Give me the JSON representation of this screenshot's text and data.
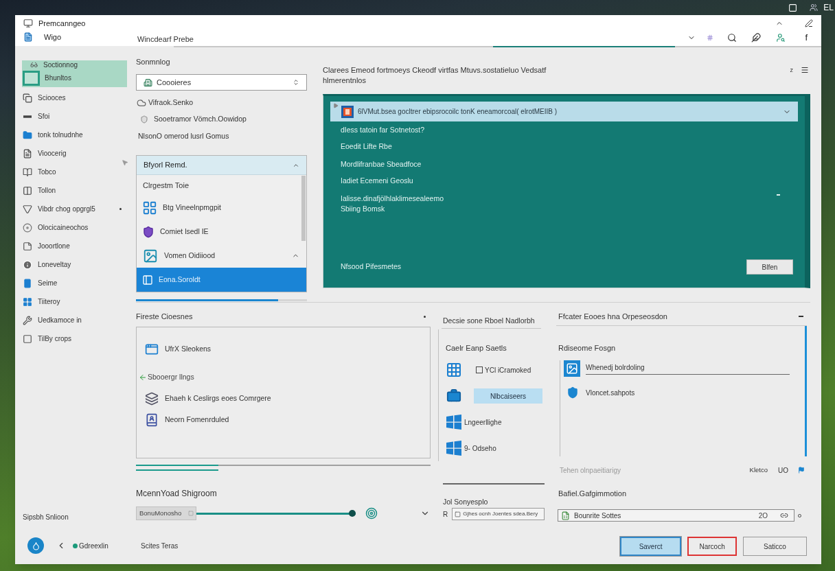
{
  "tray": {
    "label": "EL"
  },
  "window": {
    "app_name": "Premcanngeo",
    "section": "Wigo",
    "title": "Wincdearf Prebe",
    "toolbar_glyph": "f"
  },
  "sidebar": {
    "items": [
      {
        "kind": "caption",
        "label": "Soctionnog",
        "selected": true
      },
      {
        "kind": "tile",
        "label": "Bhunltos",
        "selected": true
      },
      {
        "kind": "item",
        "label": "Sciooces",
        "selected": false
      },
      {
        "kind": "item",
        "label": "Sfoi",
        "selected": false
      },
      {
        "kind": "item",
        "label": "tonk tolnudnhe",
        "selected": false
      },
      {
        "kind": "item",
        "label": "Vioocerig",
        "selected": false
      },
      {
        "kind": "item",
        "label": "Tobco",
        "selected": false
      },
      {
        "kind": "item",
        "label": "Tollon",
        "selected": false
      },
      {
        "kind": "item",
        "label": "Vibdr chog opgrgl5",
        "selected": false,
        "has_dot": true
      },
      {
        "kind": "item",
        "label": "Olocicaineochos",
        "selected": false
      },
      {
        "kind": "item",
        "label": "Jooortlone",
        "selected": false
      },
      {
        "kind": "item",
        "label": "Loneveltay",
        "selected": false
      },
      {
        "kind": "item",
        "label": "Seime",
        "selected": false
      },
      {
        "kind": "item",
        "label": "Tiiteroy",
        "selected": false
      },
      {
        "kind": "item",
        "label": "Uedkamoce in",
        "selected": false
      },
      {
        "kind": "item",
        "label": "TilBy crops",
        "selected": false
      }
    ],
    "footer": "Sipsbh Snlioon"
  },
  "bottom_bar": {
    "status": "Gdreexlin",
    "link": "Scites Teras"
  },
  "search_panel": {
    "label": "Sonmnlog",
    "dropdown": {
      "value": "Coooieres"
    },
    "options": [
      "Vifraok.Senko",
      "Sooetramor Vömch.Oowidop"
    ],
    "note": "NlsonO omerod lusrl Gomus",
    "list": {
      "header": "Bfyorl Remd.",
      "group": "Clrgestm Toie",
      "items": [
        {
          "label": "Btg Vineelnpmgpit",
          "selected": false
        },
        {
          "label": "Comiet lsedl IE",
          "selected": false
        },
        {
          "label": "Vomen Oidiiood",
          "selected": false,
          "expandable": true
        },
        {
          "label": "Eona.Soroldt",
          "selected": true
        }
      ]
    },
    "progress": {
      "level": 0.83
    }
  },
  "notice": {
    "text": "Clarees Emeod fortmoeys Ckeodf virtfas Mtuvs.sostatieluo Vedsatf hlmerentnlos",
    "badge": "z"
  },
  "card": {
    "header": "6lVMut.bsea gocltrer ebipsrocoilc tonK eneamorcoal( elrotMEIIB )",
    "groups": [
      {
        "kind": "pair",
        "lines": [
          "dIess tatoin far Sotnetost?",
          "Eoedit Lifte Rbe"
        ]
      },
      {
        "kind": "pair",
        "lines": [
          "Mordlifranbae Sbeadfoce",
          "Iadiet Ecemeni Geoslu"
        ]
      },
      {
        "kind": "note",
        "lines": [
          "Ialisse.dinafjölhlaklimesealeemo",
          "Sbiing Bomsk"
        ]
      }
    ],
    "footer": "Nfsood Pifesmetes",
    "button": "Blfen"
  },
  "recent_panel": {
    "title": "Fireste Cioesnes",
    "items": [
      {
        "kind": "app",
        "label": "UfrX Sleokens"
      },
      {
        "kind": "heading",
        "label": "Sbooergr llngs"
      },
      {
        "kind": "app",
        "label": "Ehaeh k Ceslirgs eoes Comrgere"
      },
      {
        "kind": "app",
        "label": "Neorn Fomenrduled"
      }
    ],
    "progress": {
      "level": 0.28
    }
  },
  "slider": {
    "label": "McennYoad Shigroom",
    "field": "BonuMonosho",
    "level": 1.0
  },
  "device_panel": {
    "title": "Decsie sone Rboel Nadlorbh",
    "subtitle": "Caelr Eanp Saetls",
    "items": [
      {
        "kind": "checkbox",
        "label": "YCl iCramoked",
        "checked": false
      },
      {
        "kind": "button",
        "label": "Nlbcaiseers"
      },
      {
        "kind": "text",
        "label": "Lngeerllighe"
      },
      {
        "kind": "text",
        "label": "9- Odseho"
      }
    ],
    "field_label": "Jol Sonyesplo",
    "field": {
      "prefix": "R",
      "value": "Gjhes ocnh Joentes sdea.Bery"
    }
  },
  "security_panel": {
    "title": "Ffcater Eooes hna Orpeseosdon",
    "subtitle": "Rdiseome Fosgn",
    "items": [
      {
        "label": "Whenedj bolrdoling",
        "selected": true
      },
      {
        "label": "Vloncet.sahpots",
        "selected": false
      }
    ],
    "footer": {
      "hint": "Tehen olnpaeitiarigy",
      "value": "Kletco",
      "count": "UO"
    },
    "field_label": "Bafiel.Gafgimmotion",
    "field": {
      "value": "Bounrite Sottes",
      "count": "2O"
    },
    "buttons": [
      {
        "kind": "primary",
        "label": "Saverct"
      },
      {
        "kind": "danger",
        "label": "Narcoch"
      },
      {
        "kind": "default",
        "label": "Saticco"
      }
    ]
  }
}
